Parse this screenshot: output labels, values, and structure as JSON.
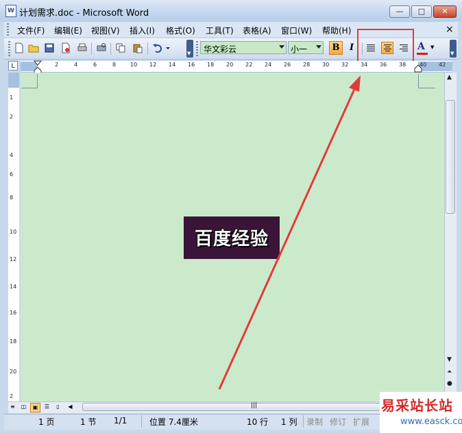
{
  "window": {
    "title": "计划需求.doc - Microsoft Word",
    "doc_icon_letter": "W"
  },
  "window_buttons": {
    "minimize": "—",
    "maximize": "□",
    "close": "✕"
  },
  "menubar": {
    "items": [
      "文件(F)",
      "编辑(E)",
      "视图(V)",
      "插入(I)",
      "格式(O)",
      "工具(T)",
      "表格(A)",
      "窗口(W)",
      "帮助(H)"
    ],
    "doc_close": "×"
  },
  "toolbar": {
    "font_name": "华文彩云",
    "font_size": "小一",
    "bold_label": "B",
    "italic_label": "I",
    "font_color_label": "A",
    "highlight_color": "#e23a3a"
  },
  "ruler": {
    "tab_selector": "L",
    "h_ticks": [
      "2",
      "4",
      "6",
      "8",
      "10",
      "12",
      "14",
      "16",
      "18",
      "20",
      "22",
      "24",
      "26",
      "28",
      "30",
      "32",
      "34",
      "36",
      "38",
      "40",
      "42"
    ],
    "v_ticks": [
      "1",
      "2",
      "4",
      "6",
      "8",
      "10",
      "12",
      "14",
      "16",
      "18",
      "20",
      "2"
    ]
  },
  "document": {
    "wordart_text": "百度经验",
    "page_color": "#cbeacb"
  },
  "scroll": {
    "up": "▲",
    "down": "▼",
    "browse_prev": "⏶",
    "browse_obj": "●",
    "h_grip": "|||",
    "left": "◀"
  },
  "statusbar": {
    "page": "1 页",
    "section": "1 节",
    "page_of": "1/1",
    "position": "位置 7.4厘米",
    "line": "10 行",
    "column": "1 列",
    "rec": "录制",
    "trk": "修订",
    "ext": "扩展"
  },
  "watermark": {
    "cn": "易采站长站",
    "en": "www.easck.com"
  }
}
